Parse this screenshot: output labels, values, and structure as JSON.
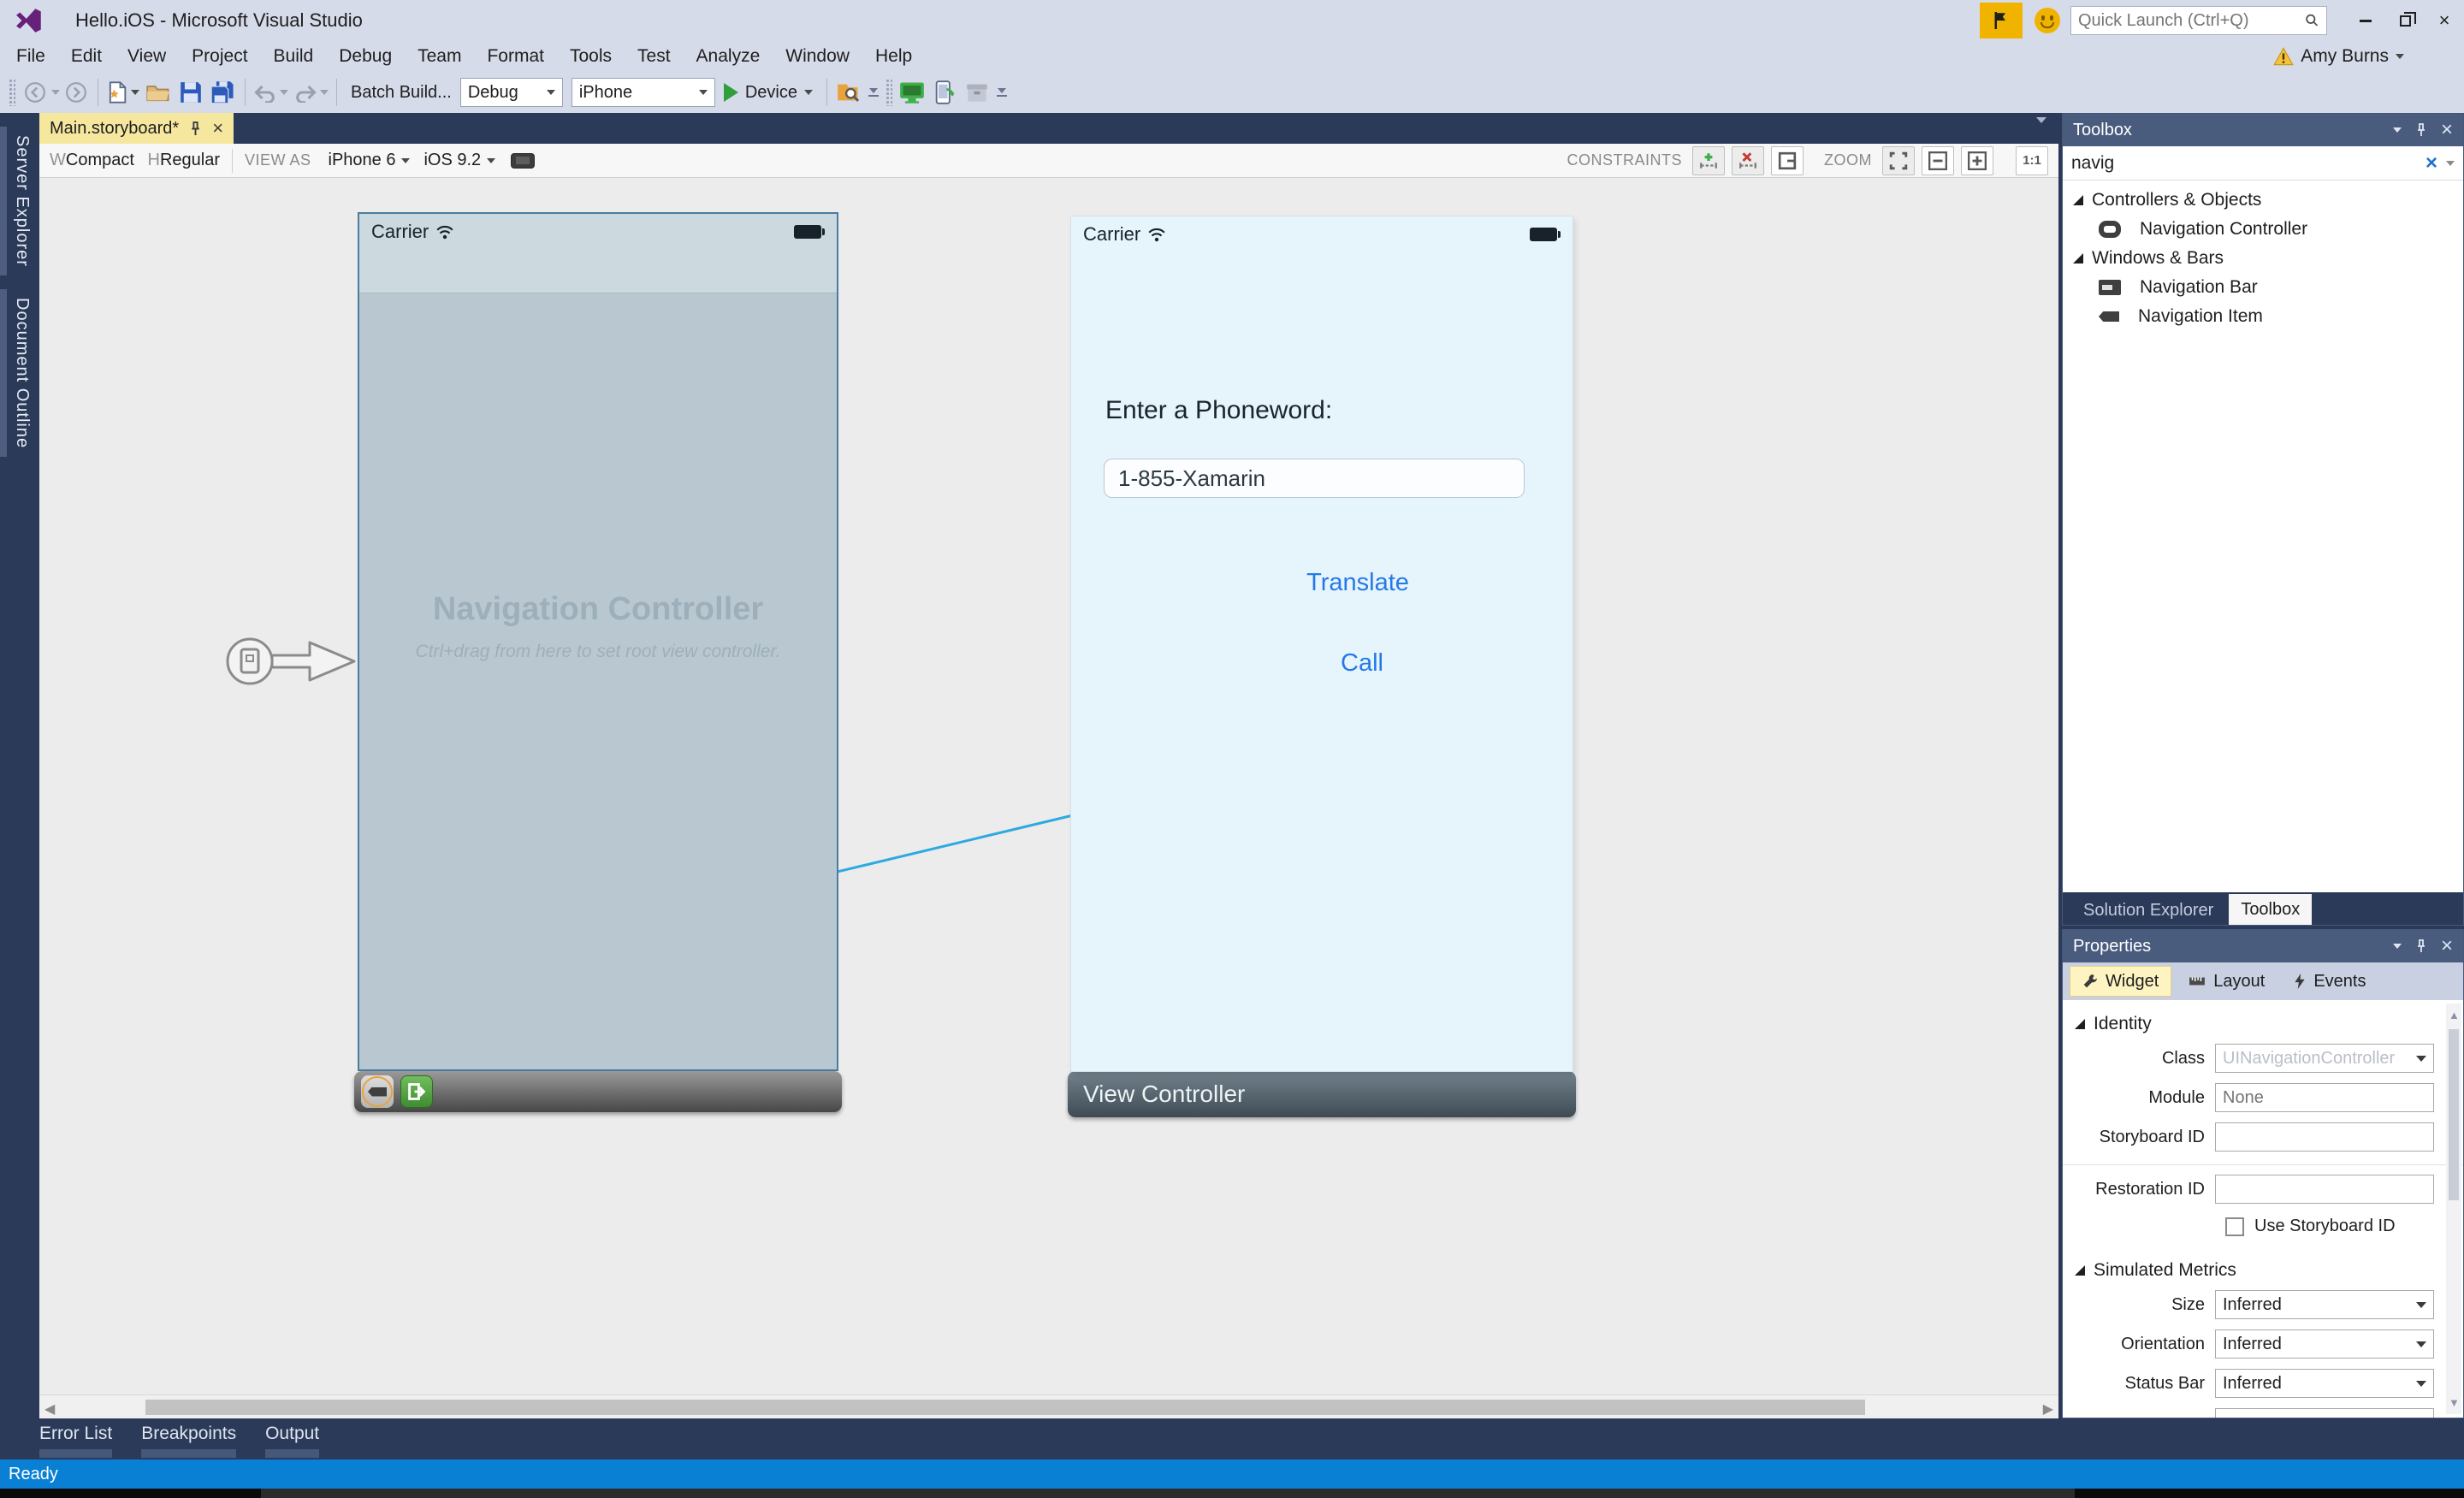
{
  "window": {
    "title": "Hello.iOS - Microsoft Visual Studio",
    "quick_launch_placeholder": "Quick Launch (Ctrl+Q)",
    "user_name": "Amy Burns"
  },
  "menu": {
    "items": [
      "File",
      "Edit",
      "View",
      "Project",
      "Build",
      "Debug",
      "Team",
      "Format",
      "Tools",
      "Test",
      "Analyze",
      "Window",
      "Help"
    ]
  },
  "toolbar": {
    "batch_build_label": "Batch Build...",
    "config_value": "Debug",
    "platform_value": "iPhone",
    "run_label": "Device"
  },
  "left_rail": {
    "tabs": [
      "Server Explorer",
      "Document Outline"
    ]
  },
  "editor": {
    "tab_label": "Main.storyboard*",
    "designer_bar": {
      "w": "W",
      "compact": "Compact",
      "h": "H",
      "regular": "Regular",
      "view_as_label": "VIEW AS",
      "device_value": "iPhone 6",
      "os_value": "iOS 9.2",
      "constraints_label": "CONSTRAINTS",
      "zoom_label": "ZOOM",
      "zoom_one": "1:1"
    }
  },
  "scenes": {
    "nav": {
      "carrier": "Carrier",
      "title": "Navigation Controller",
      "subtitle": "Ctrl+drag from here to set root view controller."
    },
    "view": {
      "carrier": "Carrier",
      "prompt": "Enter a Phoneword:",
      "phone_value": "1-855-Xamarin",
      "translate_label": "Translate",
      "call_label": "Call",
      "bar_title": "View Controller"
    }
  },
  "toolbox": {
    "title": "Toolbox",
    "search_value": "navig",
    "group1_label": "Controllers & Objects",
    "item1_label": "Navigation Controller",
    "group2_label": "Windows & Bars",
    "item2_label": "Navigation Bar",
    "item3_label": "Navigation Item",
    "tab_solution": "Solution Explorer",
    "tab_toolbox": "Toolbox"
  },
  "properties": {
    "title": "Properties",
    "tab_widget": "Widget",
    "tab_layout": "Layout",
    "tab_events": "Events",
    "identity_header": "Identity",
    "class_label": "Class",
    "class_value": "UINavigationController",
    "module_label": "Module",
    "module_placeholder": "None",
    "storyboard_id_label": "Storyboard ID",
    "restoration_id_label": "Restoration ID",
    "use_storyboard_label": "Use Storyboard ID",
    "metrics_header": "Simulated Metrics",
    "size_label": "Size",
    "size_value": "Inferred",
    "orientation_label": "Orientation",
    "orientation_value": "Inferred",
    "statusbar_label": "Status Bar",
    "statusbar_value": "Inferred"
  },
  "bottom": {
    "tabs": [
      "Error List",
      "Breakpoints",
      "Output"
    ],
    "status": "Ready"
  },
  "colors": {
    "shell_dark": "#2b3a58",
    "panel_header": "#4a5c7e",
    "chrome_light": "#d6dbe9",
    "tab_gold": "#f5e79e",
    "status_blue": "#0980d4",
    "segue_blue": "#2da9e1",
    "ios_link_blue": "#2479e9",
    "accent_yellow": "#f0b400"
  }
}
